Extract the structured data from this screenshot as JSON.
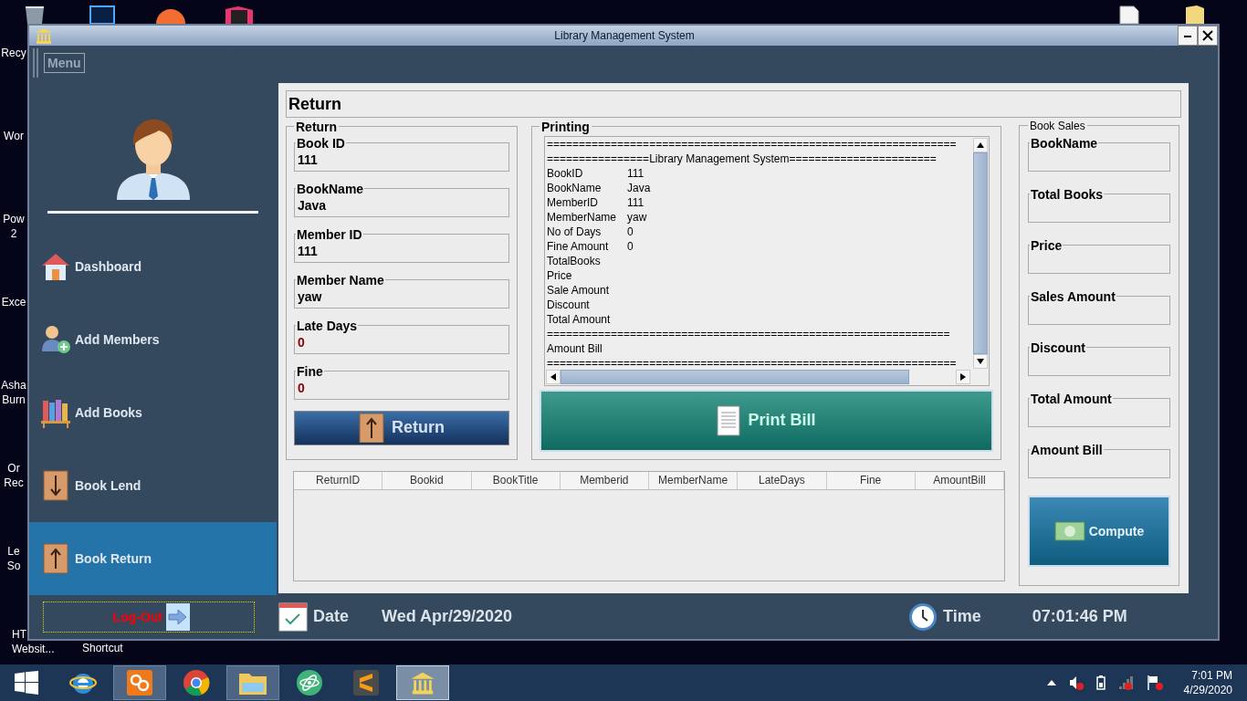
{
  "desktop_icons": [
    {
      "lines": [
        "Recy"
      ]
    },
    {
      "lines": [
        "Wor"
      ]
    },
    {
      "lines": [
        "Pow",
        "2"
      ]
    },
    {
      "lines": [
        "Exce"
      ]
    },
    {
      "lines": [
        "Asha",
        "Burn"
      ]
    },
    {
      "lines": [
        "Or",
        "Rec"
      ]
    },
    {
      "lines": [
        "Le",
        "So"
      ]
    },
    {
      "lines": [
        "HT",
        "Websit..."
      ]
    }
  ],
  "desktop_shortcut": "Shortcut",
  "window": {
    "title": "Library Management System",
    "menu": "Menu"
  },
  "sidebar": {
    "items": [
      {
        "label": "Dashboard",
        "kind": "dashboard",
        "selected": false
      },
      {
        "label": "Add Members",
        "kind": "member",
        "selected": false
      },
      {
        "label": "Add Books",
        "kind": "books",
        "selected": false
      },
      {
        "label": "Book Lend",
        "kind": "lend",
        "selected": false
      },
      {
        "label": "Book Return",
        "kind": "return",
        "selected": true
      }
    ]
  },
  "panel_title": "Return",
  "return_group": {
    "title": "Return",
    "fields": [
      {
        "label": "Book ID",
        "value": "111",
        "alert": false
      },
      {
        "label": "BookName",
        "value": "Java",
        "alert": false
      },
      {
        "label": "Member ID",
        "value": "111",
        "alert": false
      },
      {
        "label": "Member Name",
        "value": "yaw",
        "alert": false
      },
      {
        "label": "Late Days",
        "value": "0",
        "alert": true
      },
      {
        "label": "Fine",
        "value": "0",
        "alert": true
      }
    ],
    "button": "Return"
  },
  "printing": {
    "title": "Printing",
    "lines": [
      {
        "key": "================================================================"
      },
      {
        "key": "================Library Management System======================="
      },
      {
        "key": "BookID",
        "value": "111"
      },
      {
        "key": "BookName",
        "value": "Java"
      },
      {
        "key": "MemberID",
        "value": "111"
      },
      {
        "key": "MemberName",
        "value": "yaw"
      },
      {
        "key": "No of Days",
        "value": "0"
      },
      {
        "key": "Fine Amount",
        "value": "0"
      },
      {
        "key": "TotalBooks"
      },
      {
        "key": "Price"
      },
      {
        "key": "Sale Amount"
      },
      {
        "key": "Discount"
      },
      {
        "key": "Total Amount"
      },
      {
        "key": "==============================================================="
      },
      {
        "key": "Amount Bill"
      },
      {
        "key": "================================================================"
      }
    ],
    "button": "Print Bill"
  },
  "table": {
    "columns": [
      "ReturnID",
      "Bookid",
      "BookTitle",
      "Memberid",
      "MemberName",
      "LateDays",
      "Fine",
      "AmountBill"
    ]
  },
  "book_sales": {
    "title": "Book Sales",
    "fields": [
      "BookName",
      "Total Books",
      "Price",
      "Sales Amount",
      "Discount",
      "Total Amount",
      "Amount Bill"
    ],
    "button": "Compute"
  },
  "bottom": {
    "logout": "Log-Out",
    "date_label": "Date",
    "date": "Wed Apr/29/2020",
    "time_label": "Time",
    "time": "07:01:46 PM"
  },
  "taskbar": {
    "apps": [
      {
        "kind": "start",
        "running": false,
        "selected": false
      },
      {
        "kind": "browser-e",
        "running": false,
        "selected": false
      },
      {
        "kind": "server",
        "running": true,
        "selected": false
      },
      {
        "kind": "chrome",
        "running": false,
        "selected": false
      },
      {
        "kind": "explorer",
        "running": true,
        "selected": false
      },
      {
        "kind": "atom",
        "running": false,
        "selected": false
      },
      {
        "kind": "sublime",
        "running": false,
        "selected": false
      },
      {
        "kind": "library",
        "running": true,
        "selected": true
      }
    ],
    "time": "7:01 PM",
    "date": "4/29/2020"
  }
}
